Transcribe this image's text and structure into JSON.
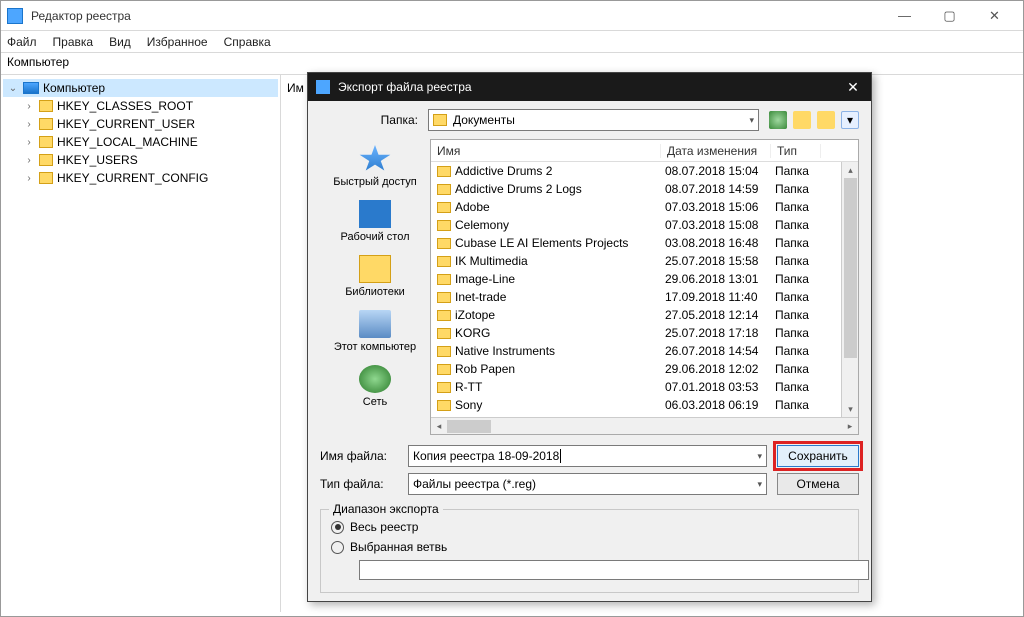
{
  "window": {
    "title": "Редактор реестра",
    "minimize": "—",
    "maximize": "▢",
    "close": "✕"
  },
  "menu": {
    "file": "Файл",
    "edit": "Правка",
    "view": "Вид",
    "favorites": "Избранное",
    "help": "Справка"
  },
  "addressbar": "Компьютер",
  "tree": {
    "root": "Компьютер",
    "items": [
      "HKEY_CLASSES_ROOT",
      "HKEY_CURRENT_USER",
      "HKEY_LOCAL_MACHINE",
      "HKEY_USERS",
      "HKEY_CURRENT_CONFIG"
    ]
  },
  "right_label": "Им",
  "dialog": {
    "title": "Экспорт файла реестра",
    "folder_label": "Папка:",
    "folder_value": "Документы",
    "columns": {
      "name": "Имя",
      "date": "Дата изменения",
      "type": "Тип"
    },
    "places": {
      "quick": "Быстрый доступ",
      "desktop": "Рабочий стол",
      "libraries": "Библиотеки",
      "thispc": "Этот компьютер",
      "network": "Сеть"
    },
    "files": [
      {
        "name": "Addictive Drums 2",
        "date": "08.07.2018 15:04",
        "type": "Папка"
      },
      {
        "name": "Addictive Drums 2 Logs",
        "date": "08.07.2018 14:59",
        "type": "Папка"
      },
      {
        "name": "Adobe",
        "date": "07.03.2018 15:06",
        "type": "Папка"
      },
      {
        "name": "Celemony",
        "date": "07.03.2018 15:08",
        "type": "Папка"
      },
      {
        "name": "Cubase LE AI Elements Projects",
        "date": "03.08.2018 16:48",
        "type": "Папка"
      },
      {
        "name": "IK Multimedia",
        "date": "25.07.2018 15:58",
        "type": "Папка"
      },
      {
        "name": "Image-Line",
        "date": "29.06.2018 13:01",
        "type": "Папка"
      },
      {
        "name": "Inet-trade",
        "date": "17.09.2018 11:40",
        "type": "Папка"
      },
      {
        "name": "iZotope",
        "date": "27.05.2018 12:14",
        "type": "Папка"
      },
      {
        "name": "KORG",
        "date": "25.07.2018 17:18",
        "type": "Папка"
      },
      {
        "name": "Native Instruments",
        "date": "26.07.2018 14:54",
        "type": "Папка"
      },
      {
        "name": "Rob Papen",
        "date": "29.06.2018 12:02",
        "type": "Папка"
      },
      {
        "name": "R-TT",
        "date": "07.01.2018 03:53",
        "type": "Папка"
      },
      {
        "name": "Sony",
        "date": "06.03.2018 06:19",
        "type": "Папка"
      }
    ],
    "filename_label": "Имя файла:",
    "filename_value": "Копия реестра 18-09-2018",
    "filetype_label": "Тип файла:",
    "filetype_value": "Файлы реестра (*.reg)",
    "save": "Сохранить",
    "cancel": "Отмена",
    "range_legend": "Диапазон экспорта",
    "range_all": "Весь реестр",
    "range_branch": "Выбранная ветвь"
  }
}
